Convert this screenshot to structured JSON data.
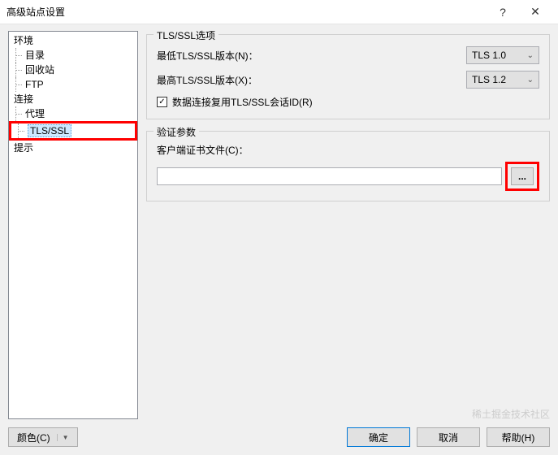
{
  "title": "高级站点设置",
  "titlebar": {
    "help": "?",
    "close": "✕"
  },
  "tree": {
    "env": "环境",
    "dir": "目录",
    "recycle": "回收站",
    "ftp": "FTP",
    "conn": "连接",
    "proxy": "代理",
    "tlsssl": "TLS/SSL",
    "prompt": "提示"
  },
  "tls_group": {
    "title": "TLS/SSL选项",
    "min_label": "最低TLS/SSL版本(N)：",
    "min_value": "TLS 1.0",
    "max_label": "最高TLS/SSL版本(X)：",
    "max_value": "TLS 1.2",
    "reuse_label": "数据连接复用TLS/SSL会话ID(R)"
  },
  "auth_group": {
    "title": "验证参数",
    "cert_label": "客户端证书文件(C)：",
    "cert_value": "",
    "browse": "..."
  },
  "footer": {
    "color": "颜色(C)",
    "ok": "确定",
    "cancel": "取消",
    "help": "帮助(H)"
  },
  "watermark": "稀土掘金技术社区"
}
